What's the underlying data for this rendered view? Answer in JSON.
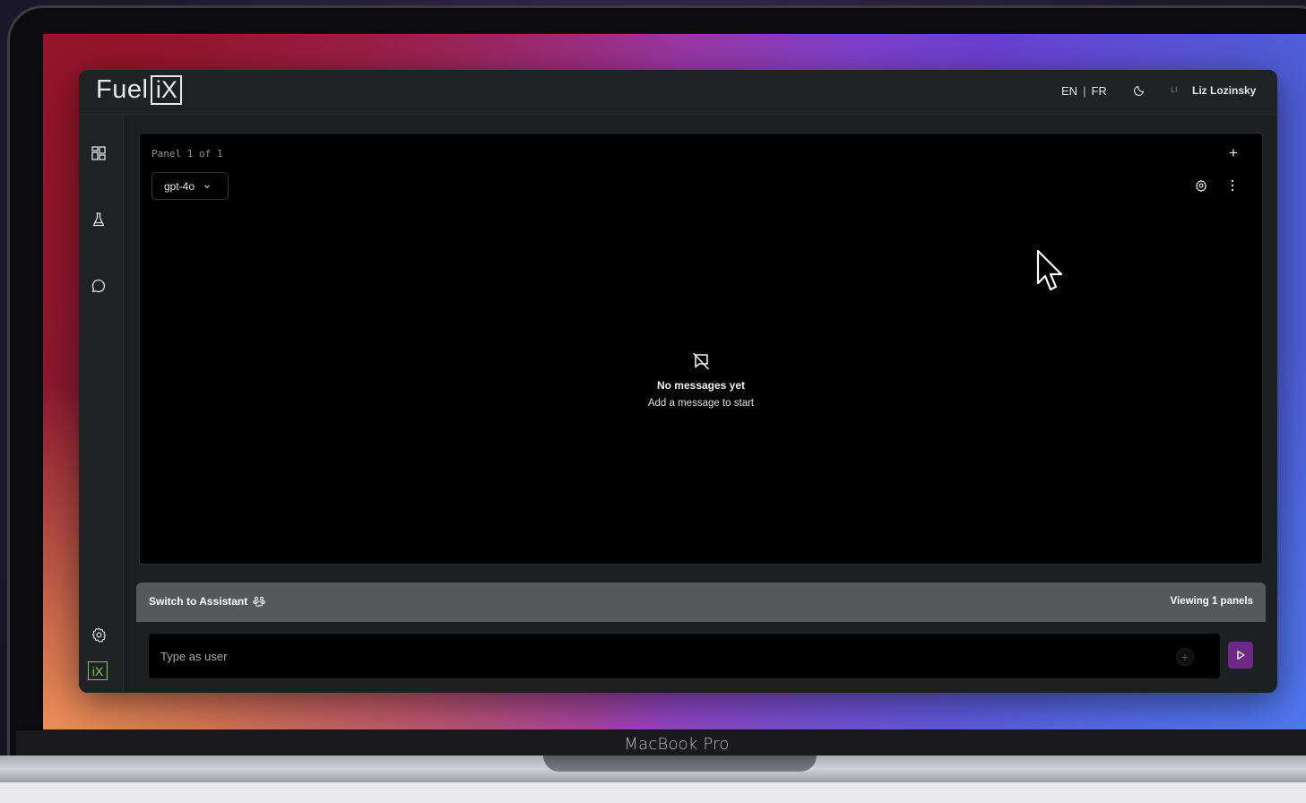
{
  "device": {
    "label": "MacBook Pro"
  },
  "brand": {
    "word": "Fuel",
    "box": "iX",
    "badge": "iX",
    "badge_color": "#7bd13b"
  },
  "header": {
    "lang_en": "EN",
    "lang_sep": "|",
    "lang_fr": "FR",
    "theme_icon": "moon-icon",
    "user_initials": "LI",
    "user_name": "Liz Lozinsky"
  },
  "sidebar": {
    "items": [
      {
        "name": "dashboard-icon"
      },
      {
        "name": "flask-icon"
      },
      {
        "name": "chat-bubble-icon"
      }
    ],
    "bottom": [
      {
        "name": "settings-icon"
      },
      {
        "name": "ix-logo-icon"
      }
    ]
  },
  "panel": {
    "label": "Panel 1 of 1",
    "add_label": "+",
    "model": "gpt-4o",
    "empty_title": "No messages yet",
    "empty_subtitle": "Add a message to start"
  },
  "composer": {
    "switch_label": "Switch to Assistant",
    "viewing_label": "Viewing 1 panels",
    "input_placeholder": "Type as user",
    "input_value": "",
    "attach_label": "+",
    "send_color": "#6c2a86"
  },
  "colors": {
    "app_bg": "#1d1f21",
    "panel_bg": "#000000",
    "assist_bar": "#56595c",
    "accent": "#6c2a86"
  }
}
